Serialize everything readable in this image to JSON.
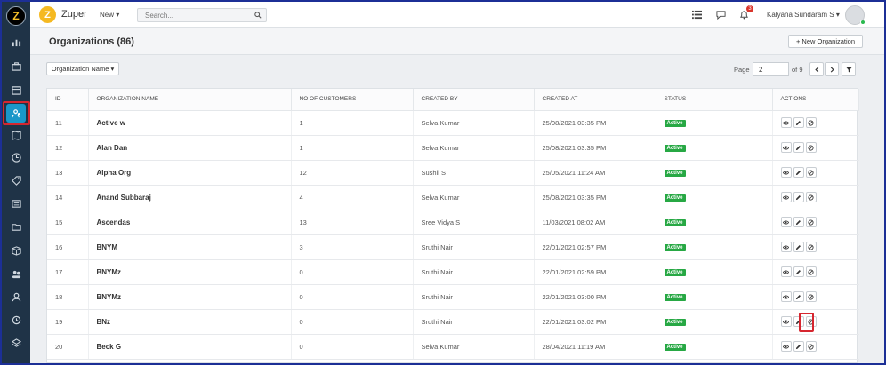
{
  "app": {
    "brand": "Zuper",
    "logo_letter": "Z",
    "new_menu": "New ▾",
    "search_placeholder": "Search...",
    "notification_count": "3",
    "user_name": "Kalyana Sundaram S ▾"
  },
  "sidebar": {
    "items": [
      {
        "icon": "bar-chart-icon"
      },
      {
        "icon": "briefcase-icon"
      },
      {
        "icon": "calendar-icon"
      },
      {
        "icon": "organization-icon",
        "active": true
      },
      {
        "icon": "map-icon"
      },
      {
        "icon": "clock-icon"
      },
      {
        "icon": "tag-icon"
      },
      {
        "icon": "list-icon"
      },
      {
        "icon": "folder-icon"
      },
      {
        "icon": "box-icon"
      },
      {
        "icon": "users-icon"
      },
      {
        "icon": "user-icon"
      },
      {
        "icon": "history-icon"
      },
      {
        "icon": "layers-icon"
      }
    ]
  },
  "page": {
    "title": "Organizations (86)",
    "new_button": "+  New Organization",
    "filter_label": "Organization Name ▾",
    "pager": {
      "label": "Page",
      "current": "2",
      "of": "of 9"
    }
  },
  "table": {
    "columns": [
      "ID",
      "ORGANIZATION NAME",
      "NO OF CUSTOMERS",
      "CREATED BY",
      "CREATED AT",
      "STATUS",
      "ACTIONS"
    ],
    "rows": [
      {
        "id": "11",
        "name": "Active w",
        "customers": "1",
        "created_by": "Selva Kumar",
        "created_at": "25/08/2021 03:35 PM",
        "status": "Active"
      },
      {
        "id": "12",
        "name": "Alan Dan",
        "customers": "1",
        "created_by": "Selva Kumar",
        "created_at": "25/08/2021 03:35 PM",
        "status": "Active"
      },
      {
        "id": "13",
        "name": "Alpha Org",
        "customers": "12",
        "created_by": "Sushil S",
        "created_at": "25/05/2021 11:24 AM",
        "status": "Active"
      },
      {
        "id": "14",
        "name": "Anand Subbaraj",
        "customers": "4",
        "created_by": "Selva Kumar",
        "created_at": "25/08/2021 03:35 PM",
        "status": "Active"
      },
      {
        "id": "15",
        "name": "Ascendas",
        "customers": "13",
        "created_by": "Sree Vidya S",
        "created_at": "11/03/2021 08:02 AM",
        "status": "Active"
      },
      {
        "id": "16",
        "name": "BNYM",
        "customers": "3",
        "created_by": "Sruthi Nair",
        "created_at": "22/01/2021 02:57 PM",
        "status": "Active"
      },
      {
        "id": "17",
        "name": "BNYMz",
        "customers": "0",
        "created_by": "Sruthi Nair",
        "created_at": "22/01/2021 02:59 PM",
        "status": "Active"
      },
      {
        "id": "18",
        "name": "BNYMz",
        "customers": "0",
        "created_by": "Sruthi Nair",
        "created_at": "22/01/2021 03:00 PM",
        "status": "Active"
      },
      {
        "id": "19",
        "name": "BNz",
        "customers": "0",
        "created_by": "Sruthi Nair",
        "created_at": "22/01/2021 03:02 PM",
        "status": "Active"
      },
      {
        "id": "20",
        "name": "Beck G",
        "customers": "0",
        "created_by": "Selva Kumar",
        "created_at": "28/04/2021 11:19 AM",
        "status": "Active"
      }
    ]
  },
  "colors": {
    "sidebar_bg": "#1f3347",
    "active_accent": "#1a97c9",
    "status_active": "#27a844",
    "highlight": "#d6262f"
  }
}
